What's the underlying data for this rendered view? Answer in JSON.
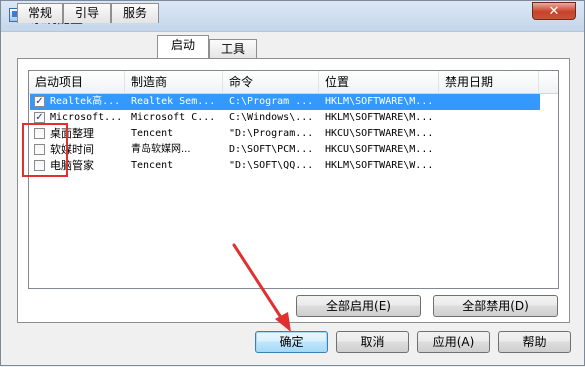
{
  "window": {
    "title": "系统配置",
    "close_label": "✕"
  },
  "tabs": [
    {
      "label": "常规"
    },
    {
      "label": "引导"
    },
    {
      "label": "服务"
    },
    {
      "label": "启动",
      "active": true
    },
    {
      "label": "工具"
    }
  ],
  "table": {
    "headers": [
      "启动项目",
      "制造商",
      "命令",
      "位置",
      "禁用日期"
    ],
    "rows": [
      {
        "checked": true,
        "selected": true,
        "item": "Realtek高...",
        "maker": "Realtek Sem...",
        "command": "C:\\Program ...",
        "location": "HKLM\\SOFTWARE\\M...",
        "disabled_date": ""
      },
      {
        "checked": true,
        "selected": false,
        "item": "Microsoft...",
        "maker": "Microsoft C...",
        "command": "C:\\Windows\\...",
        "location": "HKLM\\SOFTWARE\\M...",
        "disabled_date": ""
      },
      {
        "checked": false,
        "selected": false,
        "item": "桌面整理",
        "maker": "Tencent",
        "command": "\"D:\\Program...",
        "location": "HKCU\\SOFTWARE\\M...",
        "disabled_date": ""
      },
      {
        "checked": false,
        "selected": false,
        "item": "软媒时间",
        "maker": "青岛软媒网...",
        "command": "D:\\SOFT\\PCM...",
        "location": "HKCU\\SOFTWARE\\M...",
        "disabled_date": ""
      },
      {
        "checked": false,
        "selected": false,
        "item": "电脑管家",
        "maker": "Tencent",
        "command": "\"D:\\SOFT\\QQ...",
        "location": "HKLM\\SOFTWARE\\W...",
        "disabled_date": ""
      }
    ]
  },
  "list_buttons": {
    "enable_all": "全部启用(E)",
    "disable_all": "全部禁用(D)"
  },
  "footer_buttons": {
    "ok": "确定",
    "cancel": "取消",
    "apply": "应用(A)",
    "help": "帮助"
  },
  "colors": {
    "selection": "#3399ff",
    "annotation": "#e03030"
  }
}
